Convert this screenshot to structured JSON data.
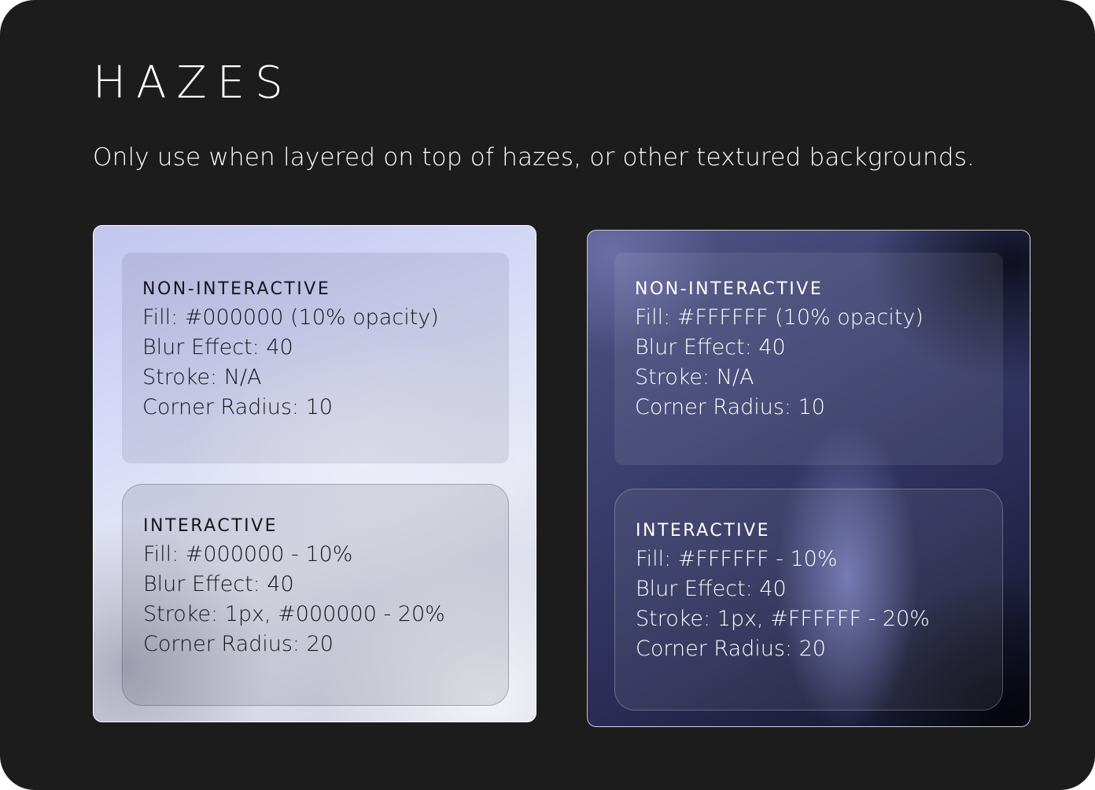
{
  "header": {
    "title": "HAZES",
    "subtitle": "Only use when layered on top of hazes, or other textured backgrounds."
  },
  "light_panel": {
    "non_interactive": {
      "label": "NON-INTERACTIVE",
      "fill": "Fill: #000000 (10% opacity)",
      "blur": "Blur Effect: 40",
      "stroke": "Stroke: N/A",
      "radius": "Corner Radius: 10"
    },
    "interactive": {
      "label": "INTERACTIVE",
      "fill": "Fill: #000000 - 10%",
      "blur": "Blur Effect: 40",
      "stroke": "Stroke: 1px, #000000 - 20%",
      "radius": "Corner Radius: 20"
    }
  },
  "dark_panel": {
    "non_interactive": {
      "label": "NON-INTERACTIVE",
      "fill": "Fill: #FFFFFF (10% opacity)",
      "blur": "Blur Effect: 40",
      "stroke": "Stroke: N/A",
      "radius": "Corner Radius: 10"
    },
    "interactive": {
      "label": "INTERACTIVE",
      "fill": "Fill: #FFFFFF - 10%",
      "blur": "Blur Effect: 40",
      "stroke": "Stroke: 1px, #FFFFFF - 20%",
      "radius": "Corner Radius: 20"
    }
  },
  "colors": {
    "background": "#1c1c1c",
    "light_text": "#15151c",
    "dark_text": "#ffffff"
  }
}
